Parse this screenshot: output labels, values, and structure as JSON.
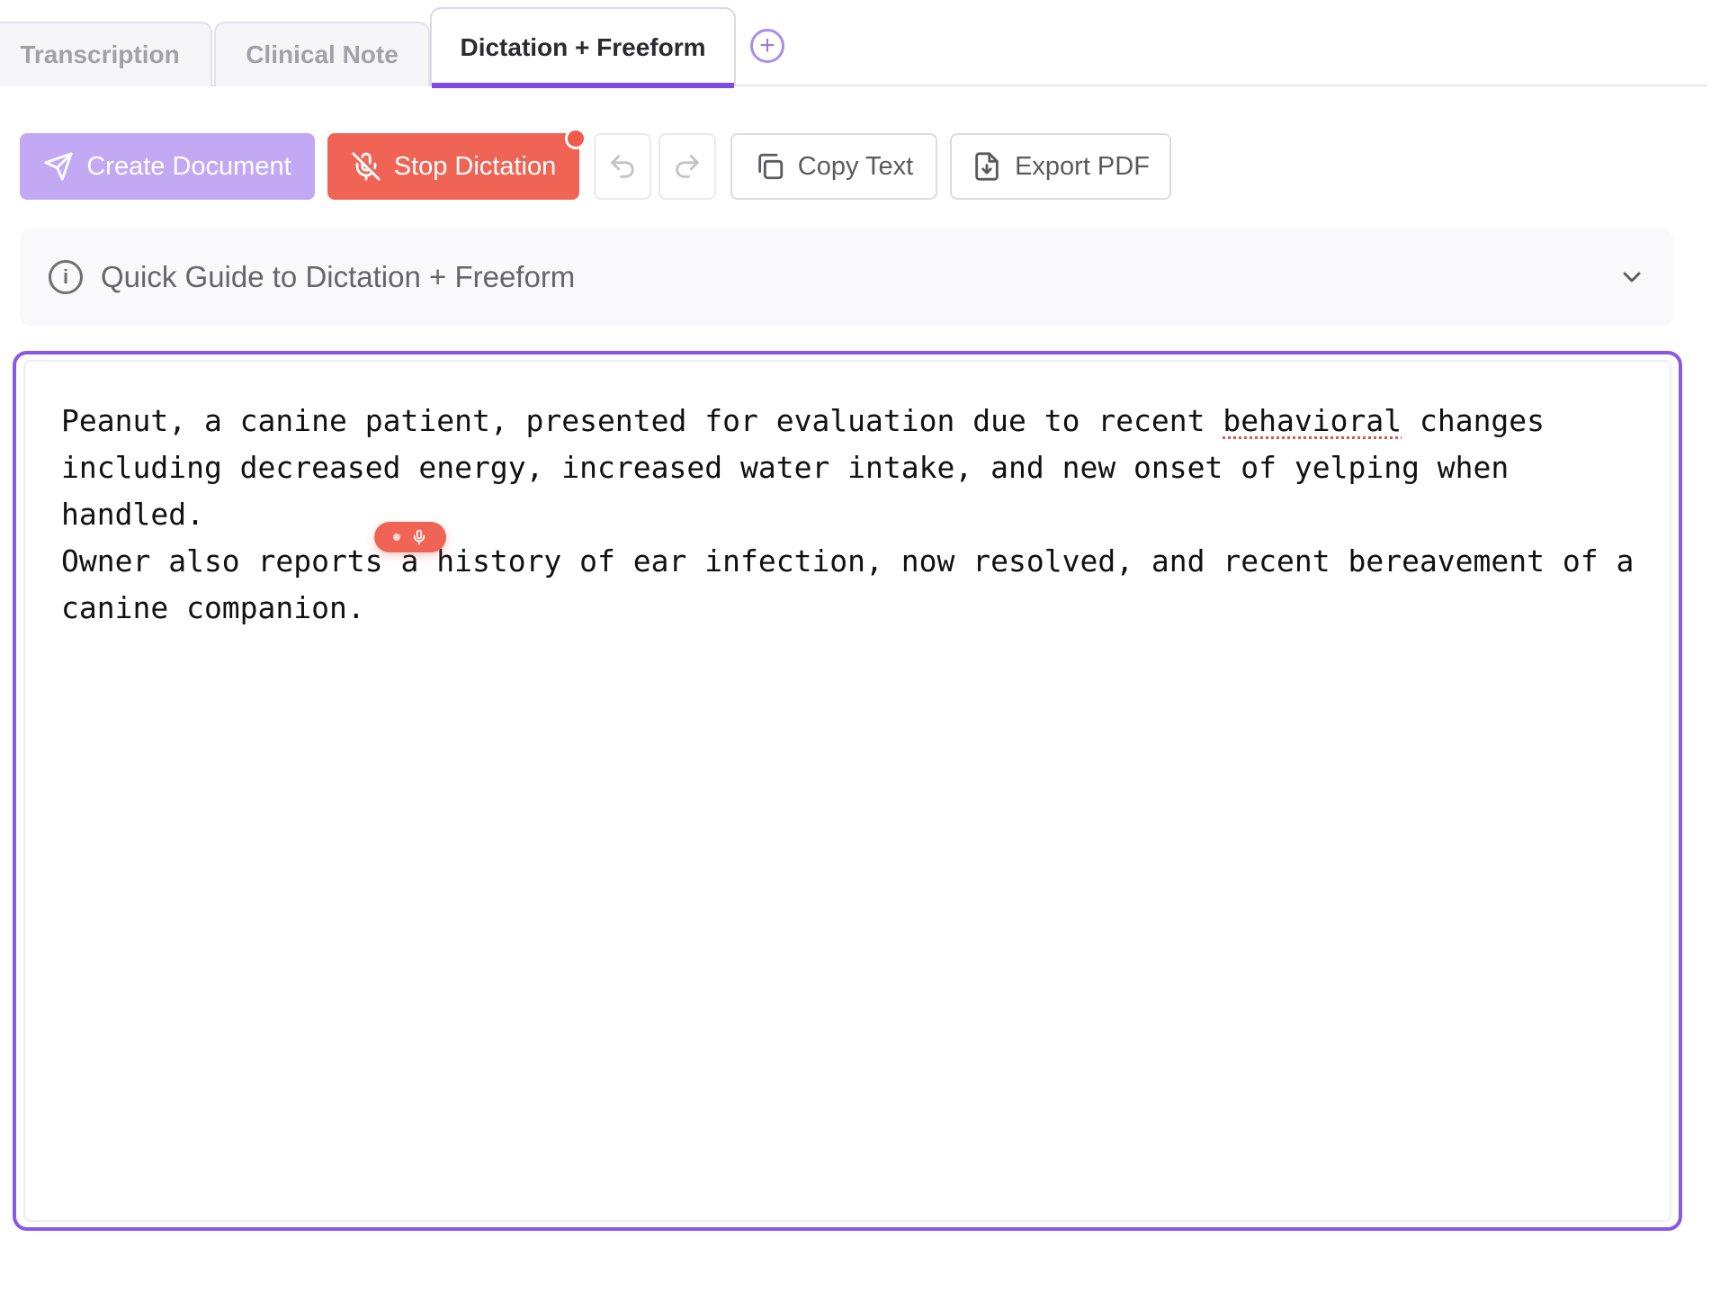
{
  "tabs": [
    {
      "label": "Transcription"
    },
    {
      "label": "Clinical Note"
    },
    {
      "label": "Dictation + Freeform",
      "active": true
    }
  ],
  "add_tab_icon": "plus-circle-icon",
  "toolbar": {
    "create_label": "Create Document",
    "stop_label": "Stop Dictation",
    "undo_icon": "undo-icon",
    "redo_icon": "redo-icon",
    "copy_label": "Copy Text",
    "export_label": "Export PDF",
    "recording": true
  },
  "guide": {
    "title": "Quick Guide to Dictation + Freeform",
    "expanded": false
  },
  "editor": {
    "text_before": "Peanut, a canine patient, presented for evaluation due to recent ",
    "flagged_word": "behavioral",
    "text_after": " changes\nincluding decreased energy, increased water intake, and new onset of yelping when handled.\nOwner also reports a history of ear infection, now resolved, and recent bereavement of a\ncanine companion."
  },
  "colors": {
    "accent": "#8a58e6",
    "create": "#c3a8f4",
    "stop": "#ef6455"
  }
}
